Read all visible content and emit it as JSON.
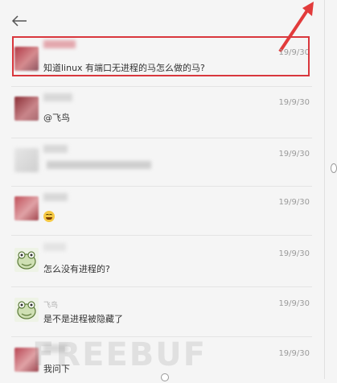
{
  "header": {
    "back_icon": "arrow-left-icon"
  },
  "annotation": {
    "arrow_color": "#e23b3b",
    "box_color": "#d9373d"
  },
  "messages": [
    {
      "name": "",
      "time": "19/9/30",
      "text": "知道linux  有端口无进程的马怎么做的马?",
      "avatar": "blurred"
    },
    {
      "name": "",
      "time": "19/9/30",
      "text": "@飞鸟",
      "avatar": "blurred"
    },
    {
      "name": "",
      "time": "19/9/30",
      "text": "",
      "avatar": "blurred"
    },
    {
      "name": "",
      "time": "19/9/30",
      "text": "",
      "avatar": "blurred",
      "emoji": "laughing-emoji-icon"
    },
    {
      "name": "",
      "time": "19/9/30",
      "text": "怎么没有进程的?",
      "avatar": "frog"
    },
    {
      "name": "飞鸟",
      "time": "19/9/30",
      "text": "是不是进程被隐藏了",
      "avatar": "frog"
    },
    {
      "name": "",
      "time": "19/9/30",
      "text": "我问下",
      "avatar": "blurred"
    }
  ],
  "watermark": "FREEBUF"
}
